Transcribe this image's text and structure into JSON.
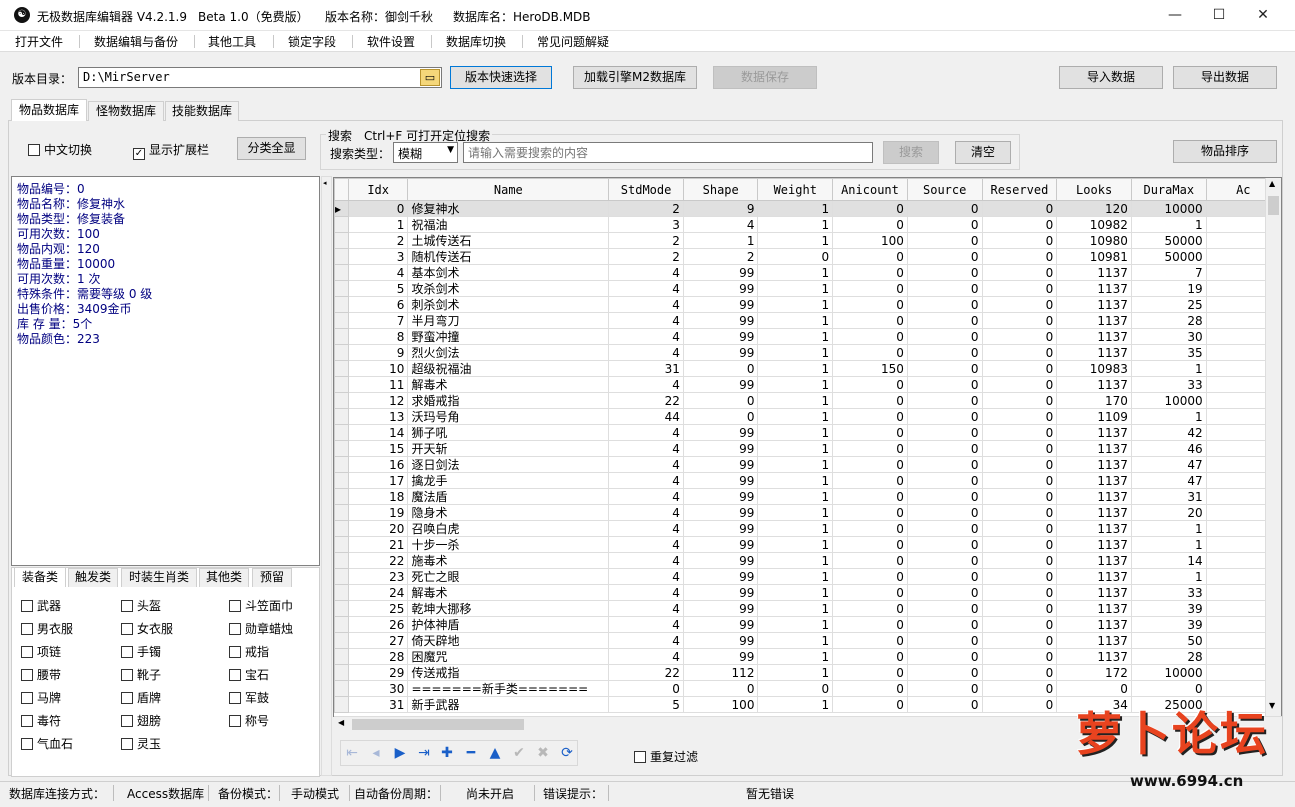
{
  "titlebar": {
    "app": "无极数据库编辑器 V4.2.1.9",
    "edition": "Beta 1.0（免费版）",
    "version_label": "版本名称：御剑千秋",
    "db_label": "数据库名：HeroDB.MDB"
  },
  "menu": [
    "打开文件",
    "数据编辑与备份",
    "其他工具",
    "锁定字段",
    "软件设置",
    "数据库切换",
    "常见问题解疑"
  ],
  "toolbar": {
    "dir_label": "版本目录：",
    "dir_value": "D:\\MirServer",
    "quick_select": "版本快速选择",
    "load_engine": "加载引擎M2数据库",
    "save": "数据保存",
    "import": "导入数据",
    "export": "导出数据"
  },
  "tabs": [
    "物品数据库",
    "怪物数据库",
    "技能数据库"
  ],
  "options": {
    "chinese": "中文切换",
    "show_ext": "显示扩展栏",
    "show_all": "分类全显"
  },
  "search": {
    "title": "搜索　Ctrl+F 可打开定位搜索",
    "type_label": "搜索类型：",
    "type_value": "模糊",
    "placeholder": "请输入需要搜索的内容",
    "button": "搜索",
    "clear": "清空",
    "sort": "物品排序"
  },
  "info": [
    "物品编号：0",
    "物品名称：修复神水",
    "物品类型：修复装备",
    "可用次数：100",
    "物品内观：120",
    "物品重量：10000",
    "可用次数：1 次",
    "特殊条件：需要等级 0 级",
    "出售价格：3409金币",
    "库 存 量：5个",
    "物品颜色：223"
  ],
  "category_tabs": [
    "装备类",
    "触发类",
    "时装生肖类",
    "其他类",
    "预留"
  ],
  "categories": [
    "武器",
    "头盔",
    "斗笠面巾",
    "男衣服",
    "女衣服",
    "勋章蜡烛",
    "项链",
    "手镯",
    "戒指",
    "腰带",
    "靴子",
    "宝石",
    "马牌",
    "盾牌",
    "军鼓",
    "毒符",
    "翅膀",
    "称号",
    "气血石",
    "灵玉"
  ],
  "columns": [
    "Idx",
    "Name",
    "StdMode",
    "Shape",
    "Weight",
    "Anicount",
    "Source",
    "Reserved",
    "Looks",
    "DuraMax",
    "Ac"
  ],
  "rows": [
    [
      "0",
      "修复神水",
      "2",
      "9",
      "1",
      "0",
      "0",
      "0",
      "120",
      "10000"
    ],
    [
      "1",
      "祝福油",
      "3",
      "4",
      "1",
      "0",
      "0",
      "0",
      "10982",
      "1"
    ],
    [
      "2",
      "土城传送石",
      "2",
      "1",
      "1",
      "100",
      "0",
      "0",
      "10980",
      "50000"
    ],
    [
      "3",
      "随机传送石",
      "2",
      "2",
      "0",
      "0",
      "0",
      "0",
      "10981",
      "50000"
    ],
    [
      "4",
      "基本剑术",
      "4",
      "99",
      "1",
      "0",
      "0",
      "0",
      "1137",
      "7"
    ],
    [
      "5",
      "攻杀剑术",
      "4",
      "99",
      "1",
      "0",
      "0",
      "0",
      "1137",
      "19"
    ],
    [
      "6",
      "刺杀剑术",
      "4",
      "99",
      "1",
      "0",
      "0",
      "0",
      "1137",
      "25"
    ],
    [
      "7",
      "半月弯刀",
      "4",
      "99",
      "1",
      "0",
      "0",
      "0",
      "1137",
      "28"
    ],
    [
      "8",
      "野蛮冲撞",
      "4",
      "99",
      "1",
      "0",
      "0",
      "0",
      "1137",
      "30"
    ],
    [
      "9",
      "烈火剑法",
      "4",
      "99",
      "1",
      "0",
      "0",
      "0",
      "1137",
      "35"
    ],
    [
      "10",
      "超级祝福油",
      "31",
      "0",
      "1",
      "150",
      "0",
      "0",
      "10983",
      "1"
    ],
    [
      "11",
      "解毒术",
      "4",
      "99",
      "1",
      "0",
      "0",
      "0",
      "1137",
      "33"
    ],
    [
      "12",
      "求婚戒指",
      "22",
      "0",
      "1",
      "0",
      "0",
      "0",
      "170",
      "10000"
    ],
    [
      "13",
      "沃玛号角",
      "44",
      "0",
      "1",
      "0",
      "0",
      "0",
      "1109",
      "1"
    ],
    [
      "14",
      "狮子吼",
      "4",
      "99",
      "1",
      "0",
      "0",
      "0",
      "1137",
      "42"
    ],
    [
      "15",
      "开天斩",
      "4",
      "99",
      "1",
      "0",
      "0",
      "0",
      "1137",
      "46"
    ],
    [
      "16",
      "逐日剑法",
      "4",
      "99",
      "1",
      "0",
      "0",
      "0",
      "1137",
      "47"
    ],
    [
      "17",
      "擒龙手",
      "4",
      "99",
      "1",
      "0",
      "0",
      "0",
      "1137",
      "47"
    ],
    [
      "18",
      "魔法盾",
      "4",
      "99",
      "1",
      "0",
      "0",
      "0",
      "1137",
      "31"
    ],
    [
      "19",
      "隐身术",
      "4",
      "99",
      "1",
      "0",
      "0",
      "0",
      "1137",
      "20"
    ],
    [
      "20",
      "召唤白虎",
      "4",
      "99",
      "1",
      "0",
      "0",
      "0",
      "1137",
      "1"
    ],
    [
      "21",
      "十步一杀",
      "4",
      "99",
      "1",
      "0",
      "0",
      "0",
      "1137",
      "1"
    ],
    [
      "22",
      "施毒术",
      "4",
      "99",
      "1",
      "0",
      "0",
      "0",
      "1137",
      "14"
    ],
    [
      "23",
      "死亡之眼",
      "4",
      "99",
      "1",
      "0",
      "0",
      "0",
      "1137",
      "1"
    ],
    [
      "24",
      "解毒术",
      "4",
      "99",
      "1",
      "0",
      "0",
      "0",
      "1137",
      "33"
    ],
    [
      "25",
      "乾坤大挪移",
      "4",
      "99",
      "1",
      "0",
      "0",
      "0",
      "1137",
      "39"
    ],
    [
      "26",
      "护体神盾",
      "4",
      "99",
      "1",
      "0",
      "0",
      "0",
      "1137",
      "39"
    ],
    [
      "27",
      "倚天辟地",
      "4",
      "99",
      "1",
      "0",
      "0",
      "0",
      "1137",
      "50"
    ],
    [
      "28",
      "困魔咒",
      "4",
      "99",
      "1",
      "0",
      "0",
      "0",
      "1137",
      "28"
    ],
    [
      "29",
      "传送戒指",
      "22",
      "112",
      "1",
      "0",
      "0",
      "0",
      "172",
      "10000"
    ],
    [
      "30",
      "=======新手类=======",
      "0",
      "0",
      "0",
      "0",
      "0",
      "0",
      "0",
      "0"
    ],
    [
      "31",
      "新手武器",
      "5",
      "100",
      "1",
      "0",
      "0",
      "0",
      "34",
      "25000"
    ]
  ],
  "nav_icons": [
    "first-icon",
    "prev-icon",
    "next-icon",
    "last-icon",
    "add-icon",
    "delete-icon",
    "up-icon",
    "post-icon",
    "cancel-icon",
    "refresh-icon"
  ],
  "nav_glyphs": [
    "⇤",
    "◂",
    "▶",
    "⇥",
    "✚",
    "━",
    "▲",
    "✔",
    "✖",
    "⟳"
  ],
  "repeat_filter": "重复过滤",
  "status": {
    "conn_label": "数据库连接方式：",
    "conn_value": "Access数据库",
    "backup_label": "备份模式：",
    "backup_value": "手动模式",
    "auto_label": "自动备份周期：",
    "auto_value": "尚未开启",
    "error_label": "错误提示：",
    "error_value": "暂无错误"
  },
  "watermark": {
    "text": "萝卜论坛",
    "url": "www.6994.cn"
  },
  "colors": {
    "info_text": "#000080",
    "nav_blue": "#1a5fc8",
    "watermark": "#e8431f"
  }
}
